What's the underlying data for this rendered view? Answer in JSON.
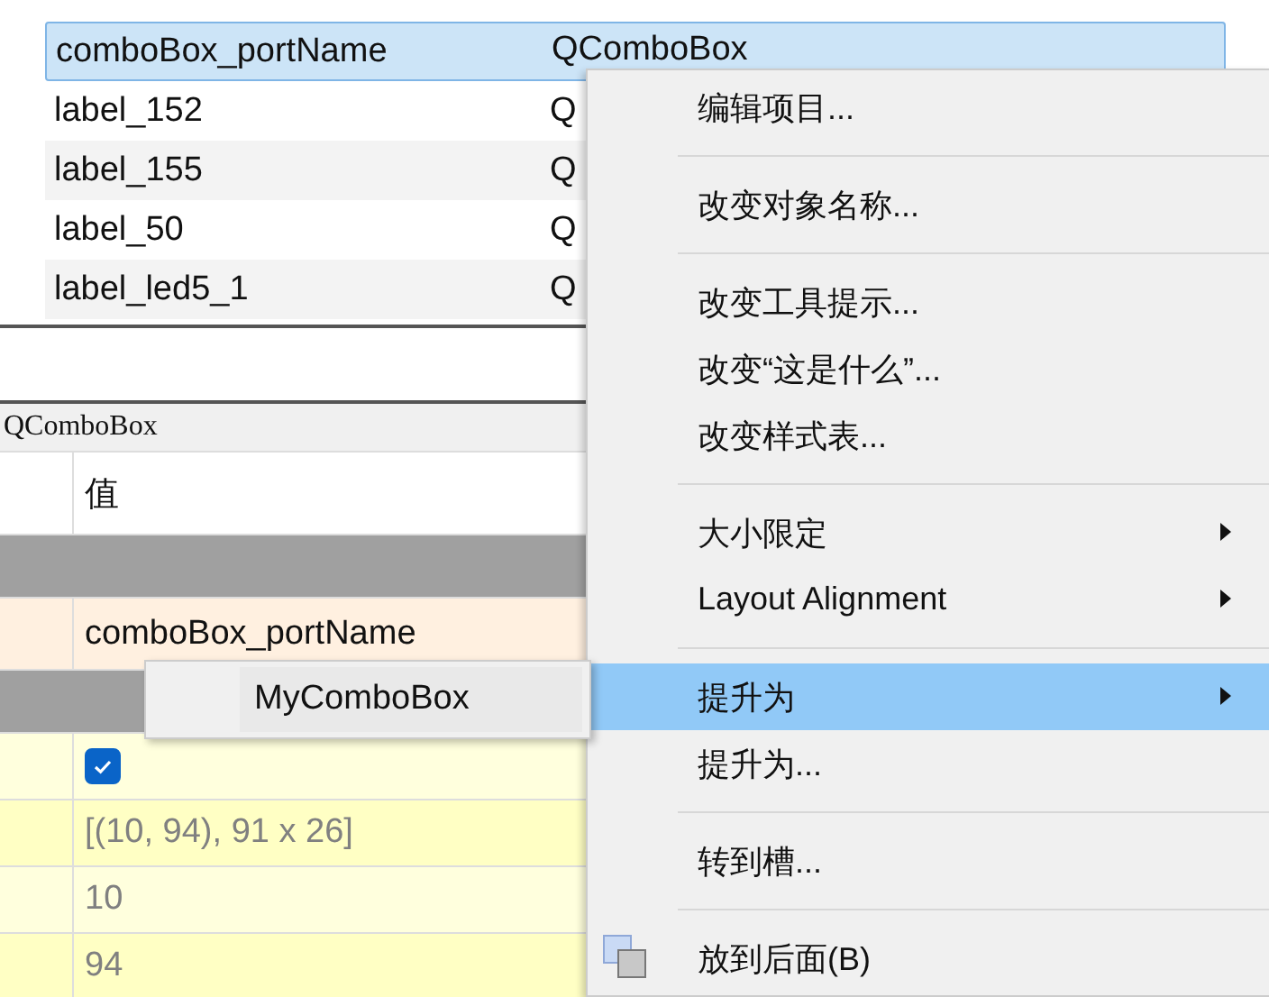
{
  "object_inspector": {
    "rows": [
      {
        "name": "comboBox_portName",
        "class": "QComboBox",
        "selected": true
      },
      {
        "name": "label_152",
        "class": "Q",
        "selected": false
      },
      {
        "name": "label_155",
        "class": "Q",
        "selected": false
      },
      {
        "name": "label_50",
        "class": "Q",
        "selected": false
      },
      {
        "name": "label_led5_1",
        "class": "Q",
        "selected": false
      }
    ]
  },
  "property_editor": {
    "class_label": "QComboBox",
    "value_header": "值",
    "rows": [
      {
        "kind": "section"
      },
      {
        "kind": "object",
        "value": "comboBox_portName"
      },
      {
        "kind": "section"
      },
      {
        "kind": "checkbox",
        "checked": true
      },
      {
        "kind": "value",
        "value": "[(10, 94), 91 x 26]"
      },
      {
        "kind": "value",
        "value": "10"
      },
      {
        "kind": "value",
        "value": "94"
      }
    ]
  },
  "context_menu": {
    "items": [
      {
        "kind": "item",
        "label": "编辑项目...",
        "submenu": false,
        "selected": false,
        "icon": false
      },
      {
        "kind": "separator"
      },
      {
        "kind": "item",
        "label": "改变对象名称...",
        "submenu": false,
        "selected": false,
        "icon": false
      },
      {
        "kind": "separator"
      },
      {
        "kind": "item",
        "label": "改变工具提示...",
        "submenu": false,
        "selected": false,
        "icon": false
      },
      {
        "kind": "item",
        "label": "改变“这是什么”...",
        "submenu": false,
        "selected": false,
        "icon": false
      },
      {
        "kind": "item",
        "label": "改变样式表...",
        "submenu": false,
        "selected": false,
        "icon": false
      },
      {
        "kind": "separator"
      },
      {
        "kind": "item",
        "label": "大小限定",
        "submenu": true,
        "selected": false,
        "icon": false
      },
      {
        "kind": "item",
        "label": "Layout Alignment",
        "submenu": true,
        "selected": false,
        "icon": false
      },
      {
        "kind": "separator"
      },
      {
        "kind": "item",
        "label": "提升为",
        "submenu": true,
        "selected": true,
        "icon": false
      },
      {
        "kind": "item",
        "label": "提升为...",
        "submenu": false,
        "selected": false,
        "icon": false
      },
      {
        "kind": "separator"
      },
      {
        "kind": "item",
        "label": "转到槽...",
        "submenu": false,
        "selected": false,
        "icon": false
      },
      {
        "kind": "separator"
      },
      {
        "kind": "item",
        "label": "放到后面(B)",
        "submenu": false,
        "selected": false,
        "icon": true
      }
    ]
  },
  "submenu": {
    "items": [
      {
        "label": "MyComboBox"
      }
    ]
  }
}
